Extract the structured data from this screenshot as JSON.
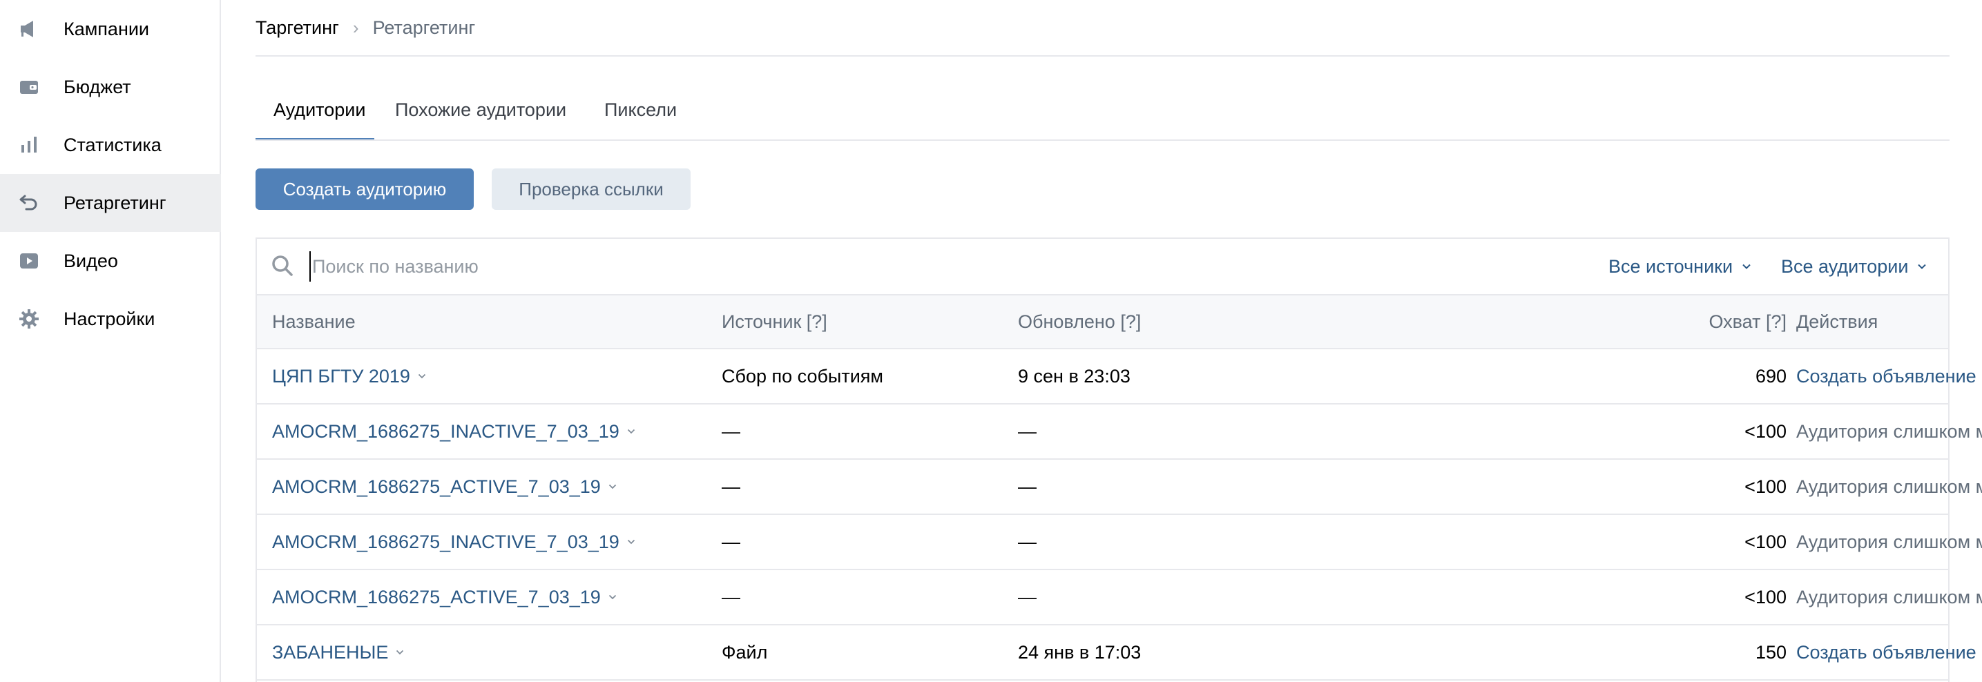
{
  "sidebar": {
    "items": [
      {
        "label": "Кампании",
        "icon": "megaphone-icon",
        "active": false
      },
      {
        "label": "Бюджет",
        "icon": "wallet-icon",
        "active": false
      },
      {
        "label": "Статистика",
        "icon": "bar-chart-icon",
        "active": false
      },
      {
        "label": "Ретаргетинг",
        "icon": "retarget-arrow-icon",
        "active": true
      },
      {
        "label": "Видео",
        "icon": "video-play-icon",
        "active": false
      },
      {
        "label": "Настройки",
        "icon": "gear-icon",
        "active": false
      }
    ]
  },
  "breadcrumb": {
    "root": "Таргетинг",
    "separator": "›",
    "current": "Ретаргетинг"
  },
  "tabs": [
    {
      "label": "Аудитории",
      "active": true
    },
    {
      "label": "Похожие аудитории",
      "active": false
    },
    {
      "label": "Пиксели",
      "active": false
    }
  ],
  "toolbar": {
    "create_label": "Создать аудиторию",
    "check_link_label": "Проверка ссылки"
  },
  "search": {
    "placeholder": "Поиск по названию",
    "value": ""
  },
  "filters": {
    "sources": "Все источники",
    "audiences": "Все аудитории"
  },
  "table": {
    "headers": {
      "name": "Название",
      "source": "Источник [?]",
      "updated": "Обновлено [?]",
      "reach": "Охват [?]",
      "actions": "Действия"
    },
    "rows": [
      {
        "name": "ЦЯП БГТУ 2019",
        "source": "Сбор по событиям",
        "updated": "9 сен в 23:03",
        "reach": "690",
        "action": "Создать объявление",
        "action_type": "link"
      },
      {
        "name": "AMOCRM_1686275_INACTIVE_7_03_19",
        "source": "—",
        "updated": "—",
        "reach": "<100",
        "action": "Аудитория слишком мала",
        "action_type": "muted"
      },
      {
        "name": "AMOCRM_1686275_ACTIVE_7_03_19",
        "source": "—",
        "updated": "—",
        "reach": "<100",
        "action": "Аудитория слишком мала",
        "action_type": "muted"
      },
      {
        "name": "AMOCRM_1686275_INACTIVE_7_03_19",
        "source": "—",
        "updated": "—",
        "reach": "<100",
        "action": "Аудитория слишком мала",
        "action_type": "muted"
      },
      {
        "name": "AMOCRM_1686275_ACTIVE_7_03_19",
        "source": "—",
        "updated": "—",
        "reach": "<100",
        "action": "Аудитория слишком мала",
        "action_type": "muted"
      },
      {
        "name": "ЗАБАНЕНЫЕ",
        "source": "Файл",
        "updated": "24 янв в 17:03",
        "reach": "150",
        "action": "Создать объявление",
        "action_type": "link"
      }
    ]
  },
  "colors": {
    "accent": "#5181b8",
    "link": "#2a5885",
    "muted": "#626d7a",
    "active_nav_bg": "#edeef0"
  }
}
